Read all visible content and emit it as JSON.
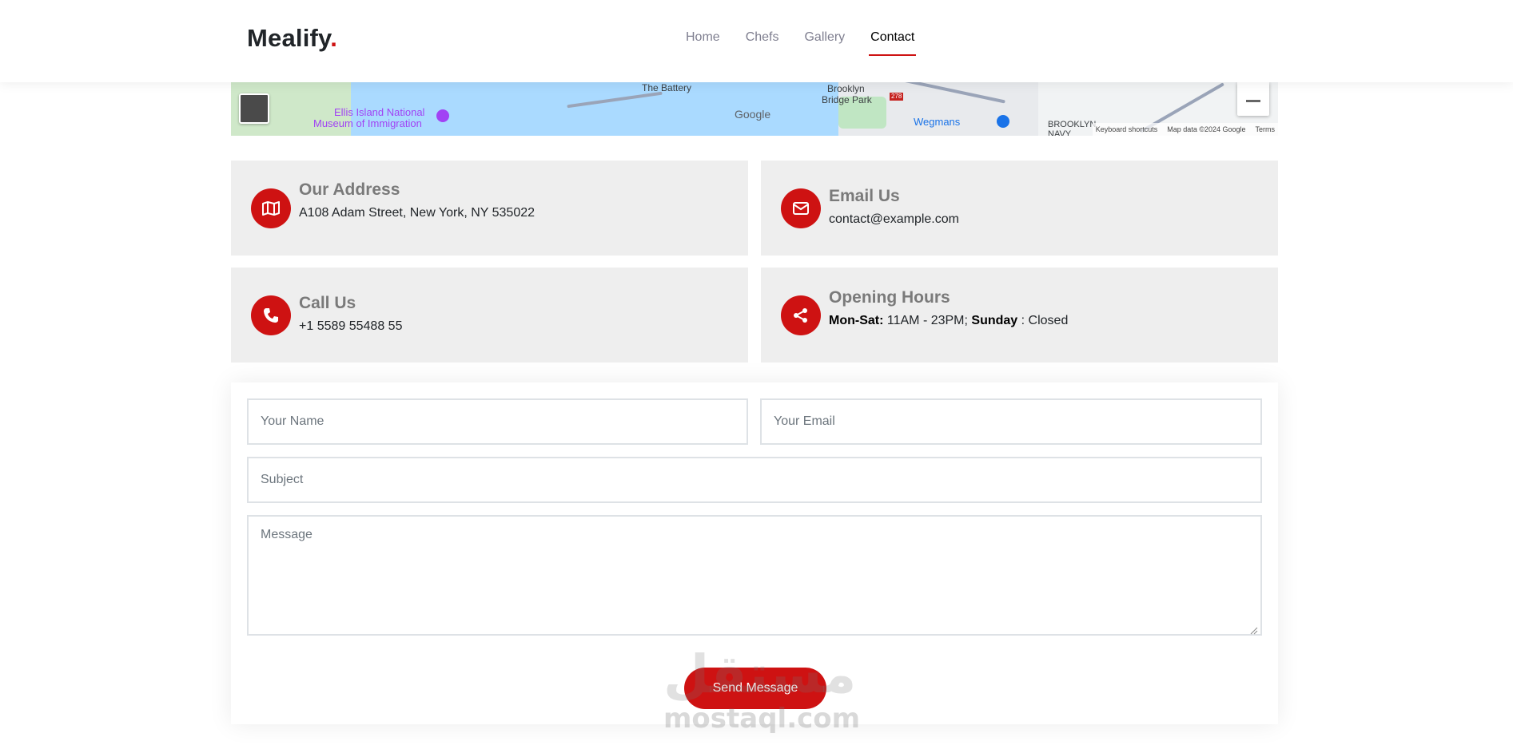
{
  "header": {
    "logo_text": "Mealify",
    "logo_dot": ".",
    "nav": [
      {
        "label": "Home",
        "active": false
      },
      {
        "label": "Chefs",
        "active": false
      },
      {
        "label": "Gallery",
        "active": false
      },
      {
        "label": "Contact",
        "active": true
      }
    ]
  },
  "map": {
    "labels": {
      "battery": "The Battery",
      "ellis_line1": "Ellis Island National",
      "ellis_line2": "Museum of Immigration",
      "brooklyn_bridge_park_1": "Brooklyn",
      "brooklyn_bridge_park_2": "Bridge Park",
      "wegmans": "Wegmans",
      "brooklyn_navy": "BROOKLYN",
      "navy": "NAVY",
      "highway": "278"
    },
    "google_logo": "Google",
    "attribution": {
      "shortcuts": "Keyboard shortcuts",
      "data": "Map data ©2024 Google",
      "terms": "Terms"
    }
  },
  "info": {
    "address": {
      "title": "Our Address",
      "text": "A108 Adam Street, New York, NY 535022",
      "icon": "map-icon"
    },
    "email": {
      "title": "Email Us",
      "text": "contact@example.com",
      "icon": "envelope-icon"
    },
    "call": {
      "title": "Call Us",
      "text": "+1 5589 55488 55",
      "icon": "phone-icon"
    },
    "hours": {
      "title": "Opening Hours",
      "weekday_label": "Mon-Sat:",
      "weekday_value": " 11AM - 23PM; ",
      "sunday_label": "Sunday",
      "sunday_value": " : Closed",
      "icon": "share-icon"
    }
  },
  "form": {
    "name_placeholder": "Your Name",
    "email_placeholder": "Your Email",
    "subject_placeholder": "Subject",
    "message_placeholder": "Message",
    "submit_label": "Send Message"
  },
  "watermark": {
    "arabic": "مستقل",
    "latin": "mostaql.com"
  },
  "colors": {
    "accent": "#ce1212",
    "info_bg": "#eeeeee",
    "nav_text": "#7f7f90"
  }
}
